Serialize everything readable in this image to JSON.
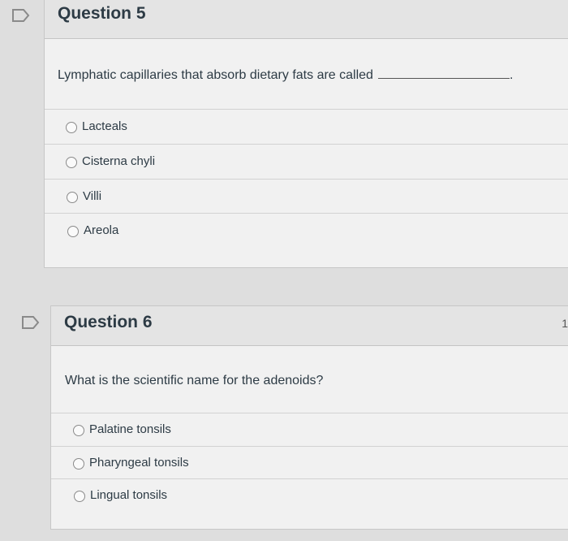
{
  "questions": [
    {
      "title": "Question 5",
      "text": "Lymphatic capillaries that absorb dietary fats are called",
      "trailing": ".",
      "answers": [
        "Lacteals",
        "Cisterna chyli",
        "Villi",
        "Areola"
      ]
    },
    {
      "title": "Question 6",
      "text": "What is the scientific name for the adenoids?",
      "answers": [
        "Palatine tonsils",
        "Pharyngeal tonsils",
        "Lingual tonsils"
      ]
    }
  ],
  "edge_mark": "1",
  "colors": {
    "text": "#2d3b45",
    "flag_outline": "#8a8a8a"
  },
  "icons": {
    "flag": "flag-icon"
  }
}
